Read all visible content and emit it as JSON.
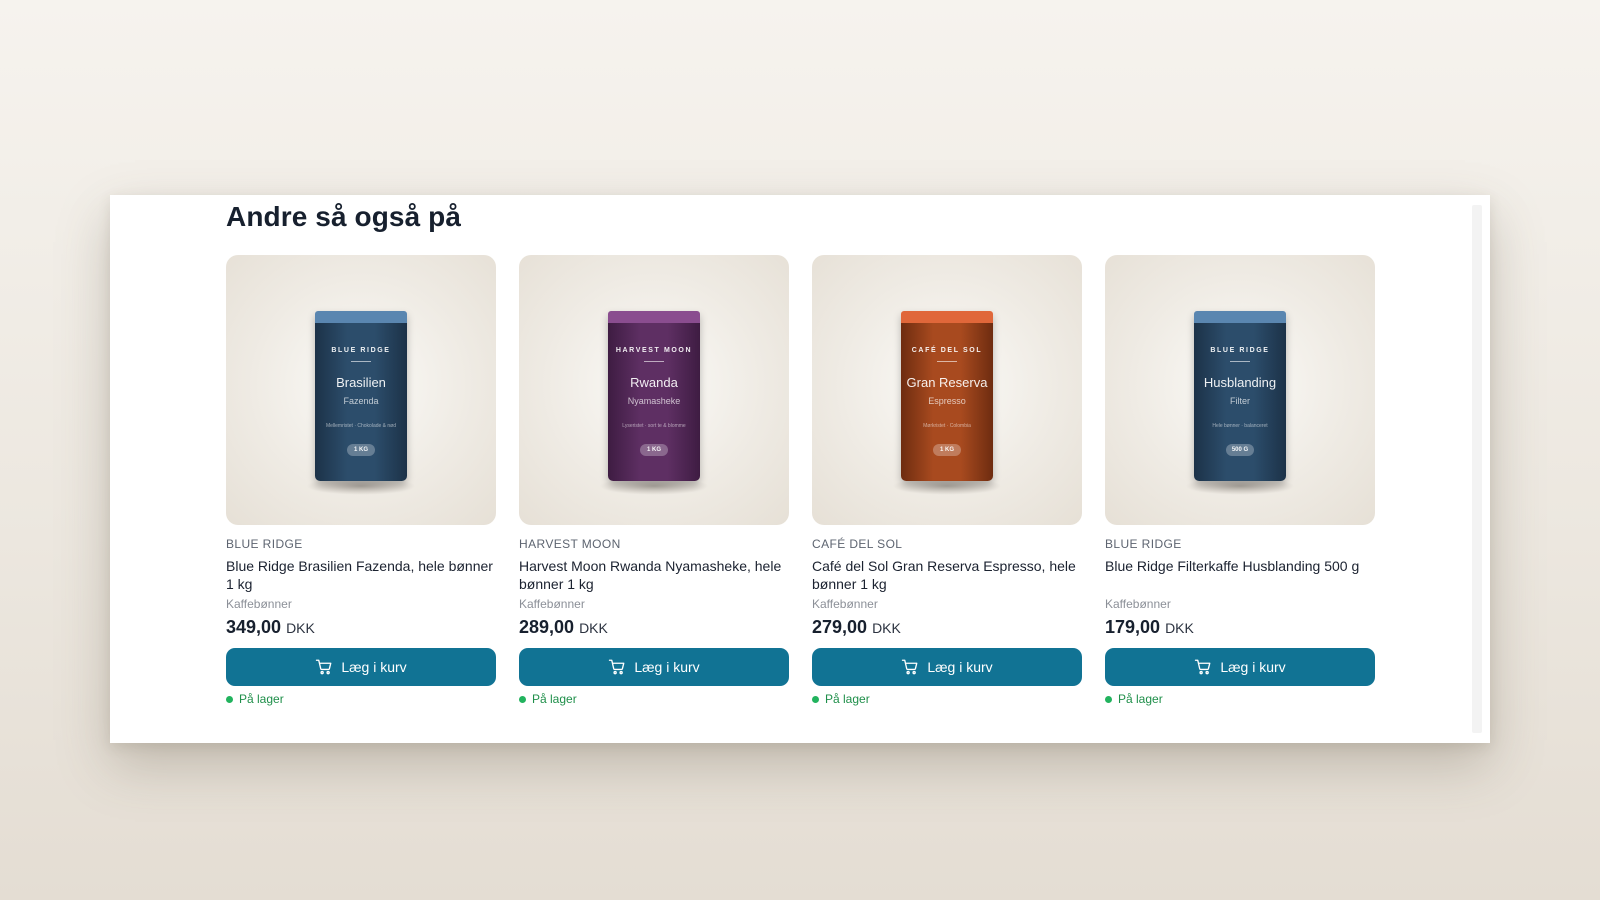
{
  "section": {
    "heading": "Andre så også på"
  },
  "products": [
    {
      "brand": "BLUE RIDGE",
      "title": "Blue Ridge Brasilien Fazenda, hele bønner 1 kg",
      "category": "Kaffebønner",
      "price": "349,00",
      "currency": "DKK",
      "button_label": "Læg i kurv",
      "stock": "På lager",
      "package": {
        "brand": "BLUE RIDGE",
        "name": "Brasilien",
        "sub": "Fazenda",
        "note": "Mellemristet · Chokolade & nød",
        "weight": "1 KG",
        "lid_color": "#5a86b0",
        "body_color": "#2c4d6b",
        "body_dark": "#1c3248"
      }
    },
    {
      "brand": "HARVEST MOON",
      "title": "Harvest Moon Rwanda Nyamasheke, hele bønner 1 kg",
      "category": "Kaffebønner",
      "price": "289,00",
      "currency": "DKK",
      "button_label": "Læg i kurv",
      "stock": "På lager",
      "package": {
        "brand": "HARVEST MOON",
        "name": "Rwanda",
        "sub": "Nyamasheke",
        "note": "Lyseristet · sort te & blomme",
        "weight": "1 KG",
        "lid_color": "#8a4d8f",
        "body_color": "#5e2f63",
        "body_dark": "#3e1c42"
      }
    },
    {
      "brand": "CAFÉ DEL SOL",
      "title": "Café del Sol Gran Reserva Espresso, hele bønner 1 kg",
      "category": "Kaffebønner",
      "price": "279,00",
      "currency": "DKK",
      "button_label": "Læg i kurv",
      "stock": "På lager",
      "package": {
        "brand": "CAFÉ DEL SOL",
        "name": "Gran Reserva",
        "sub": "Espresso",
        "note": "Mørkristet · Colombia",
        "weight": "1 KG",
        "lid_color": "#e0673a",
        "body_color": "#a84a1f",
        "body_dark": "#6e2c10"
      }
    },
    {
      "brand": "BLUE RIDGE",
      "title": "Blue Ridge Filterkaffe Husblanding 500 g",
      "category": "Kaffebønner",
      "price": "179,00",
      "currency": "DKK",
      "button_label": "Læg i kurv",
      "stock": "På lager",
      "package": {
        "brand": "BLUE RIDGE",
        "name": "Husblanding",
        "sub": "Filter",
        "note": "Hele bønner · balanceret",
        "weight": "500 G",
        "lid_color": "#5a86b0",
        "body_color": "#2c4d6b",
        "body_dark": "#1c3248"
      }
    }
  ],
  "icons": {
    "cart": "shopping-cart-icon",
    "stock": "in-stock-dot-icon"
  },
  "colors": {
    "button": "#117394",
    "stock": "#22b35e"
  }
}
